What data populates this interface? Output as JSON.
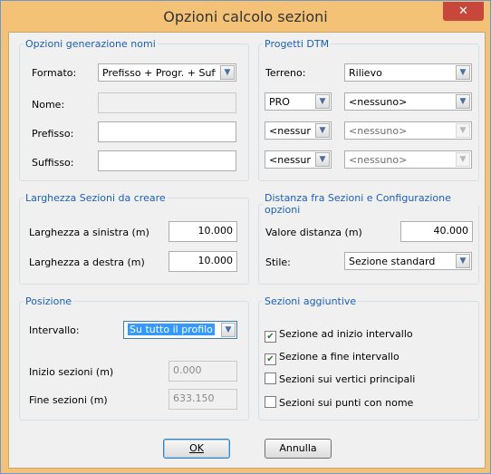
{
  "window": {
    "title": "Opzioni calcolo sezioni",
    "close_glyph": "✕"
  },
  "nomi": {
    "legend": "Opzioni generazione nomi",
    "formato_label": "Formato:",
    "formato_value": "Prefisso + Progr. + Suffisso",
    "nome_label": "Nome:",
    "nome_value": "",
    "prefisso_label": "Prefisso:",
    "prefisso_value": "",
    "suffisso_label": "Suffisso:",
    "suffisso_value": ""
  },
  "dtm": {
    "legend": "Progetti DTM",
    "terreno_label": "Terreno:",
    "terreno_value": "Rilievo",
    "rows": [
      {
        "left": "PRO",
        "right": "<nessuno>",
        "right_disabled": false
      },
      {
        "left": "<nessuno>",
        "right": "<nessuno>",
        "right_disabled": true
      },
      {
        "left": "<nessuno>",
        "right": "<nessuno>",
        "right_disabled": true
      }
    ]
  },
  "larghezza": {
    "legend": "Larghezza Sezioni da creare",
    "sinistra_label": "Larghezza a sinistra (m)",
    "sinistra_value": "10.000",
    "destra_label": "Larghezza a destra (m)",
    "destra_value": "10.000"
  },
  "distanza": {
    "legend": "Distanza fra Sezioni e Configurazione opzioni",
    "valore_label": "Valore distanza (m)",
    "valore_value": "40.000",
    "stile_label": "Stile:",
    "stile_value": "Sezione standard"
  },
  "posizione": {
    "legend": "Posizione",
    "intervallo_label": "Intervallo:",
    "intervallo_value": "Su tutto il profilo",
    "inizio_label": "Inizio sezioni (m)",
    "inizio_value": "0.000",
    "fine_label": "Fine sezioni (m)",
    "fine_value": "633.150"
  },
  "aggiuntive": {
    "legend": "Sezioni aggiuntive",
    "items": [
      {
        "label": "Sezione ad inizio intervallo",
        "checked": true
      },
      {
        "label": "Sezione a fine intervallo",
        "checked": true
      },
      {
        "label": "Sezioni sui vertici principali",
        "checked": false
      },
      {
        "label": "Sezioni sui punti con nome",
        "checked": false
      }
    ]
  },
  "buttons": {
    "ok": "OK",
    "annulla": "Annulla"
  },
  "icons": {
    "dropdown": "chevron-down-icon",
    "check": "checkmark-icon"
  }
}
